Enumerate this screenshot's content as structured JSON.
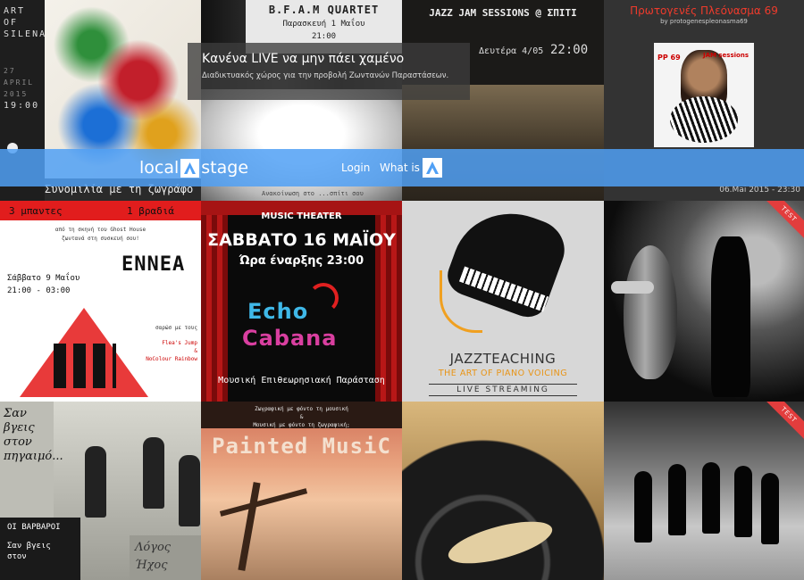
{
  "hero": {
    "title": "Κανένα LIVE να μην πάει χαμένο",
    "subtitle": "Διαδικτυακός χώρος για την προβολή Ζωντανών Παραστάσεων."
  },
  "nav": {
    "logo_left": "local",
    "logo_right": "stage",
    "login": "Login",
    "what_is": "What is",
    "accent_color": "#50a0f5"
  },
  "tiles": {
    "silena": {
      "side_title": "ART OF SILENA",
      "side_date": "27 APRIL 2015",
      "side_time": "19:00",
      "caption": "Συνομιλία με τη ζωγράφο"
    },
    "bfam": {
      "name": "B.F.A.M QUARTET",
      "date": "Παρασκευή 1 Μαΐου",
      "time": "21:00",
      "footer": "Ανακοίνωση στο ...σπίτι σου"
    },
    "jam": {
      "title": "JAZZ JAM SESSIONS @ ΣΠΙΤΙ",
      "date": "Δευτέρα 4/05",
      "time": "22:00"
    },
    "proto": {
      "title": "Πρωτογενές Πλεόνασμα 69",
      "by": "by protogenespleonasma69",
      "pp": "PP 69",
      "jam": "JAM sessions",
      "stamp": "06.Mai 2015 - 23:30"
    },
    "ennea": {
      "head_left": "3 μπαντες",
      "head_right": "1 βραδιά",
      "sub1": "από τη σκηνή του Ghost House",
      "sub2": "ζωντανά στη συσκευή σου!",
      "date": "Σάββατο 9 Μαΐου",
      "time": "21:00 - 03:00",
      "logo": "ENNEA",
      "logo_sub": "σαρώσ με τους",
      "act1": "Flea's Jump",
      "act2": "&",
      "act3": "NoColour Rainbow"
    },
    "echo": {
      "label": "MUSIC THEATER",
      "date": "ΣΑΒΒΑΤΟ 16 ΜΑΪΟΥ",
      "hour": "Ώρα έναρξης 23:00",
      "logo1": "Echo",
      "logo2": "Cabana",
      "footer": "Μουσική Επιθεωρησιακή Παράσταση"
    },
    "jazz": {
      "title": "JAZZTEACHING",
      "sub": "THE ART OF PIANO VOICING",
      "stream": "LIVE STREAMING"
    },
    "bass": {
      "ribbon": "TEST"
    },
    "varvaroi": {
      "text1": "Σαν",
      "text2": "βγεις",
      "text3": "στον",
      "text4": "πηγαιμό...",
      "band": "ΟΙ ΒΑΡΒΑΡΟΙ",
      "line1": "Σαν βγεις",
      "line2": "στον",
      "corner1": "Λόγος",
      "corner2": "Ήχος"
    },
    "painted": {
      "top1": "Ζωγραφική με φόντο τη μουσική",
      "top2": "&",
      "top3": "Μουσική με φόντο τη ζωγραφική;",
      "big": "Painted MusiC"
    },
    "band": {
      "ribbon": "TEST"
    }
  },
  "icons": [
    "A-logo-icon",
    "navbar-A-icon"
  ]
}
